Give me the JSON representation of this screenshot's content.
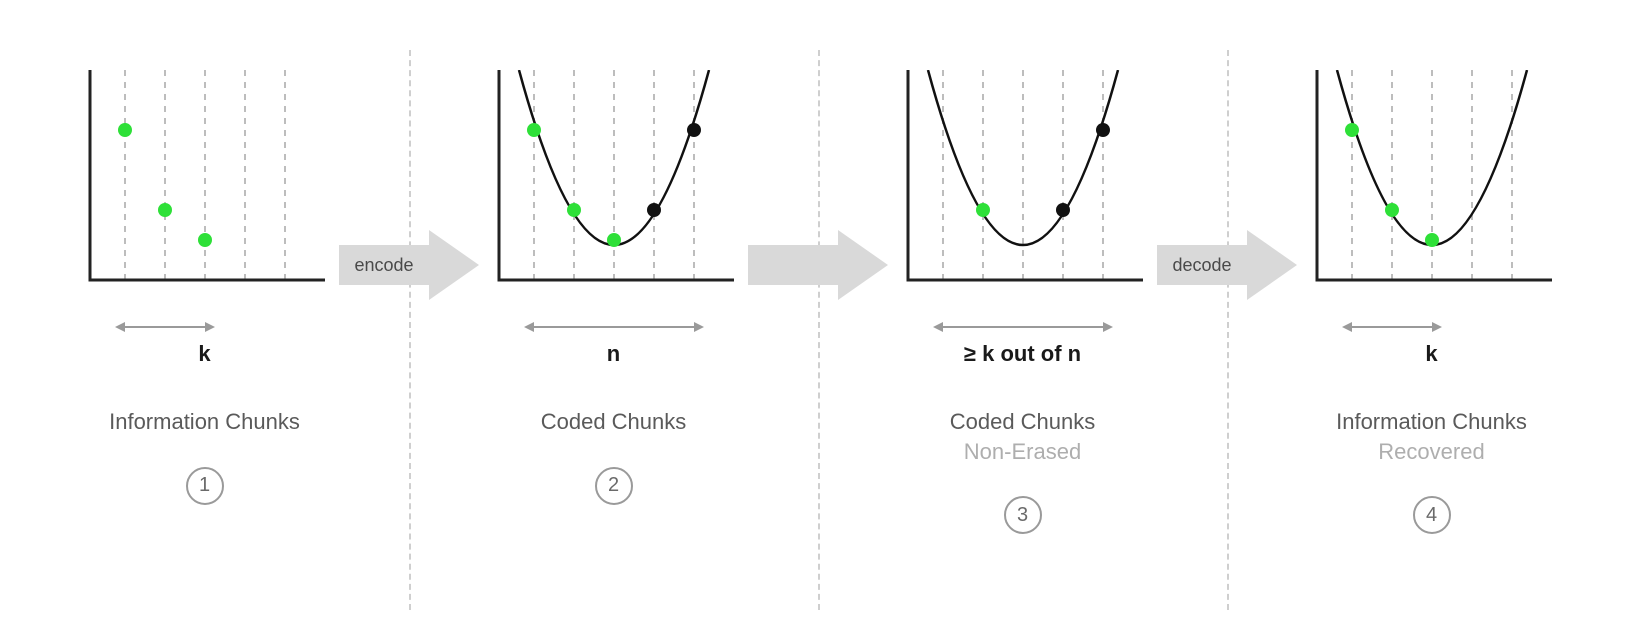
{
  "colors": {
    "green": "#2EE038",
    "black": "#111111",
    "axis": "#222222",
    "grid": "#BDBDBD",
    "arrow": "#D9D9D9"
  },
  "panels": {
    "p1": {
      "range_label": "k",
      "caption_title": "Information Chunks",
      "caption_sub": "",
      "step": "1"
    },
    "p2": {
      "range_label": "n",
      "caption_title": "Coded Chunks",
      "caption_sub": "",
      "step": "2"
    },
    "p3": {
      "range_label": "≥ k out of n",
      "caption_title": "Coded Chunks",
      "caption_sub": "Non-Erased",
      "step": "3"
    },
    "p4": {
      "range_label": "k",
      "caption_title": "Information Chunks",
      "caption_sub": "Recovered",
      "step": "4"
    }
  },
  "arrows": {
    "a1": "encode",
    "a2": "",
    "a3": "decode"
  },
  "chart_data": [
    {
      "type": "scatter",
      "title": "Information Chunks (k)",
      "x_gridlines": [
        1,
        2,
        3,
        4,
        5
      ],
      "curve": false,
      "points": [
        {
          "x": 1,
          "y": 95,
          "color": "green"
        },
        {
          "x": 2,
          "y": 45,
          "color": "green"
        },
        {
          "x": 3,
          "y": 25,
          "color": "green"
        }
      ],
      "x_range_markers": [
        1,
        3
      ],
      "x_range_label": "k"
    },
    {
      "type": "scatter",
      "title": "Coded Chunks (n)",
      "x_gridlines": [
        1,
        2,
        3,
        4,
        5
      ],
      "curve": true,
      "points": [
        {
          "x": 1,
          "y": 95,
          "color": "green"
        },
        {
          "x": 2,
          "y": 45,
          "color": "green"
        },
        {
          "x": 3,
          "y": 25,
          "color": "green"
        },
        {
          "x": 4,
          "y": 45,
          "color": "black"
        },
        {
          "x": 5,
          "y": 95,
          "color": "black"
        }
      ],
      "x_range_markers": [
        1,
        5
      ],
      "x_range_label": "n"
    },
    {
      "type": "scatter",
      "title": "Coded Chunks Non-Erased (≥ k out of n)",
      "x_gridlines": [
        1,
        2,
        3,
        4,
        5
      ],
      "curve": true,
      "points": [
        {
          "x": 2,
          "y": 45,
          "color": "green"
        },
        {
          "x": 4,
          "y": 45,
          "color": "black"
        },
        {
          "x": 5,
          "y": 95,
          "color": "black"
        }
      ],
      "x_range_markers": [
        1,
        5
      ],
      "x_range_label": "≥ k out of n"
    },
    {
      "type": "scatter",
      "title": "Information Chunks Recovered (k)",
      "x_gridlines": [
        1,
        2,
        3,
        4,
        5
      ],
      "curve": true,
      "points": [
        {
          "x": 1,
          "y": 95,
          "color": "green"
        },
        {
          "x": 2,
          "y": 45,
          "color": "green"
        },
        {
          "x": 3,
          "y": 25,
          "color": "green"
        }
      ],
      "x_range_markers": [
        1,
        3
      ],
      "x_range_label": "k"
    }
  ]
}
